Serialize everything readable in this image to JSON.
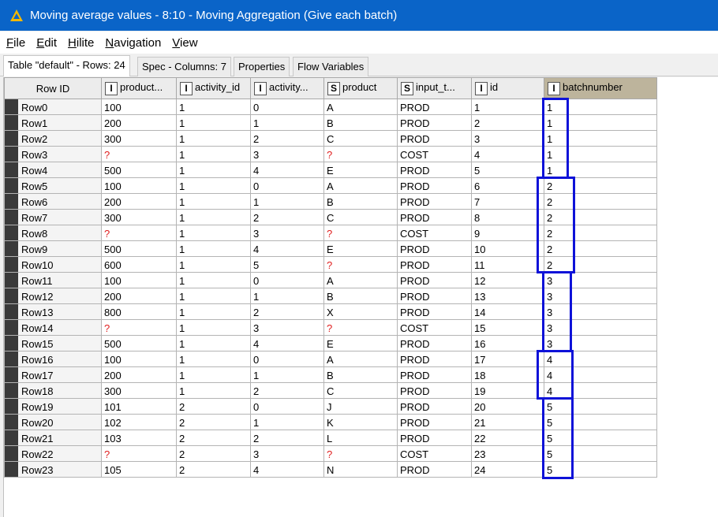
{
  "window": {
    "title": "Moving average values - 8:10 - Moving Aggregation (Give each batch)",
    "menu": [
      {
        "label": "File",
        "mnemonic_index": 0
      },
      {
        "label": "Edit",
        "mnemonic_index": 0
      },
      {
        "label": "Hilite",
        "mnemonic_index": 0
      },
      {
        "label": "Navigation",
        "mnemonic_index": 0
      },
      {
        "label": "View",
        "mnemonic_index": 0
      }
    ]
  },
  "tabs": [
    {
      "label": "Table \"default\" - Rows: 24",
      "active": true
    },
    {
      "label": "Spec - Columns: 7",
      "active": false
    },
    {
      "label": "Properties",
      "active": false
    },
    {
      "label": "Flow Variables",
      "active": false
    }
  ],
  "table": {
    "columns": [
      {
        "label": "Row ID",
        "type": ""
      },
      {
        "label": "product...",
        "type": "I"
      },
      {
        "label": "activity_id",
        "type": "I"
      },
      {
        "label": "activity...",
        "type": "I"
      },
      {
        "label": "product",
        "type": "S"
      },
      {
        "label": "input_t...",
        "type": "S"
      },
      {
        "label": "id",
        "type": "I"
      },
      {
        "label": "batchnumber",
        "type": "I"
      }
    ],
    "missing_marker": "?",
    "rows": [
      [
        "Row0",
        "100",
        "1",
        "0",
        "A",
        "PROD",
        "1",
        "1"
      ],
      [
        "Row1",
        "200",
        "1",
        "1",
        "B",
        "PROD",
        "2",
        "1"
      ],
      [
        "Row2",
        "300",
        "1",
        "2",
        "C",
        "PROD",
        "3",
        "1"
      ],
      [
        "Row3",
        "?",
        "1",
        "3",
        "?",
        "COST",
        "4",
        "1"
      ],
      [
        "Row4",
        "500",
        "1",
        "4",
        "E",
        "PROD",
        "5",
        "1"
      ],
      [
        "Row5",
        "100",
        "1",
        "0",
        "A",
        "PROD",
        "6",
        "2"
      ],
      [
        "Row6",
        "200",
        "1",
        "1",
        "B",
        "PROD",
        "7",
        "2"
      ],
      [
        "Row7",
        "300",
        "1",
        "2",
        "C",
        "PROD",
        "8",
        "2"
      ],
      [
        "Row8",
        "?",
        "1",
        "3",
        "?",
        "COST",
        "9",
        "2"
      ],
      [
        "Row9",
        "500",
        "1",
        "4",
        "E",
        "PROD",
        "10",
        "2"
      ],
      [
        "Row10",
        "600",
        "1",
        "5",
        "?",
        "PROD",
        "11",
        "2"
      ],
      [
        "Row11",
        "100",
        "1",
        "0",
        "A",
        "PROD",
        "12",
        "3"
      ],
      [
        "Row12",
        "200",
        "1",
        "1",
        "B",
        "PROD",
        "13",
        "3"
      ],
      [
        "Row13",
        "800",
        "1",
        "2",
        "X",
        "PROD",
        "14",
        "3"
      ],
      [
        "Row14",
        "?",
        "1",
        "3",
        "?",
        "COST",
        "15",
        "3"
      ],
      [
        "Row15",
        "500",
        "1",
        "4",
        "E",
        "PROD",
        "16",
        "3"
      ],
      [
        "Row16",
        "100",
        "1",
        "0",
        "A",
        "PROD",
        "17",
        "4"
      ],
      [
        "Row17",
        "200",
        "1",
        "1",
        "B",
        "PROD",
        "18",
        "4"
      ],
      [
        "Row18",
        "300",
        "1",
        "2",
        "C",
        "PROD",
        "19",
        "4"
      ],
      [
        "Row19",
        "101",
        "2",
        "0",
        "J",
        "PROD",
        "20",
        "5"
      ],
      [
        "Row20",
        "102",
        "2",
        "1",
        "K",
        "PROD",
        "21",
        "5"
      ],
      [
        "Row21",
        "103",
        "2",
        "2",
        "L",
        "PROD",
        "22",
        "5"
      ],
      [
        "Row22",
        "?",
        "2",
        "3",
        "?",
        "COST",
        "23",
        "5"
      ],
      [
        "Row23",
        "105",
        "2",
        "4",
        "N",
        "PROD",
        "24",
        "5"
      ]
    ]
  },
  "annotations": {
    "highlight_color": "#0e12d8",
    "highlighted_column": "batchnumber",
    "batch_groups": [
      {
        "batch": "1",
        "first_row": 0,
        "last_row": 4
      },
      {
        "batch": "2",
        "first_row": 5,
        "last_row": 10
      },
      {
        "batch": "3",
        "first_row": 11,
        "last_row": 15
      },
      {
        "batch": "4",
        "first_row": 16,
        "last_row": 18
      },
      {
        "batch": "5",
        "first_row": 19,
        "last_row": 23
      }
    ]
  },
  "colors": {
    "titlebar": "#0a64c8",
    "missing_value": "#e02020",
    "selected_header": "#bdb49c"
  }
}
